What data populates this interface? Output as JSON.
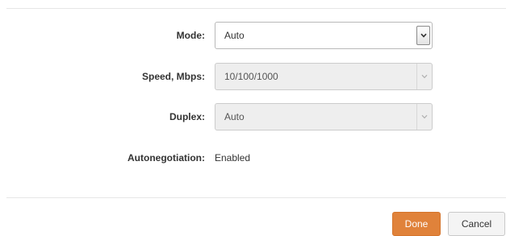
{
  "form": {
    "mode": {
      "label": "Mode:",
      "value": "Auto"
    },
    "speed": {
      "label": "Speed, Mbps:",
      "value": "10/100/1000"
    },
    "duplex": {
      "label": "Duplex:",
      "value": "Auto"
    },
    "autonegotiation": {
      "label": "Autonegotiation:",
      "value": "Enabled"
    }
  },
  "footer": {
    "done_label": "Done",
    "cancel_label": "Cancel"
  },
  "colors": {
    "done_button": "#e0823a",
    "divider": "#e6e6e6",
    "disabled_field": "#eeeeee"
  },
  "icons": {
    "select_arrow": "chevron-down-icon"
  }
}
